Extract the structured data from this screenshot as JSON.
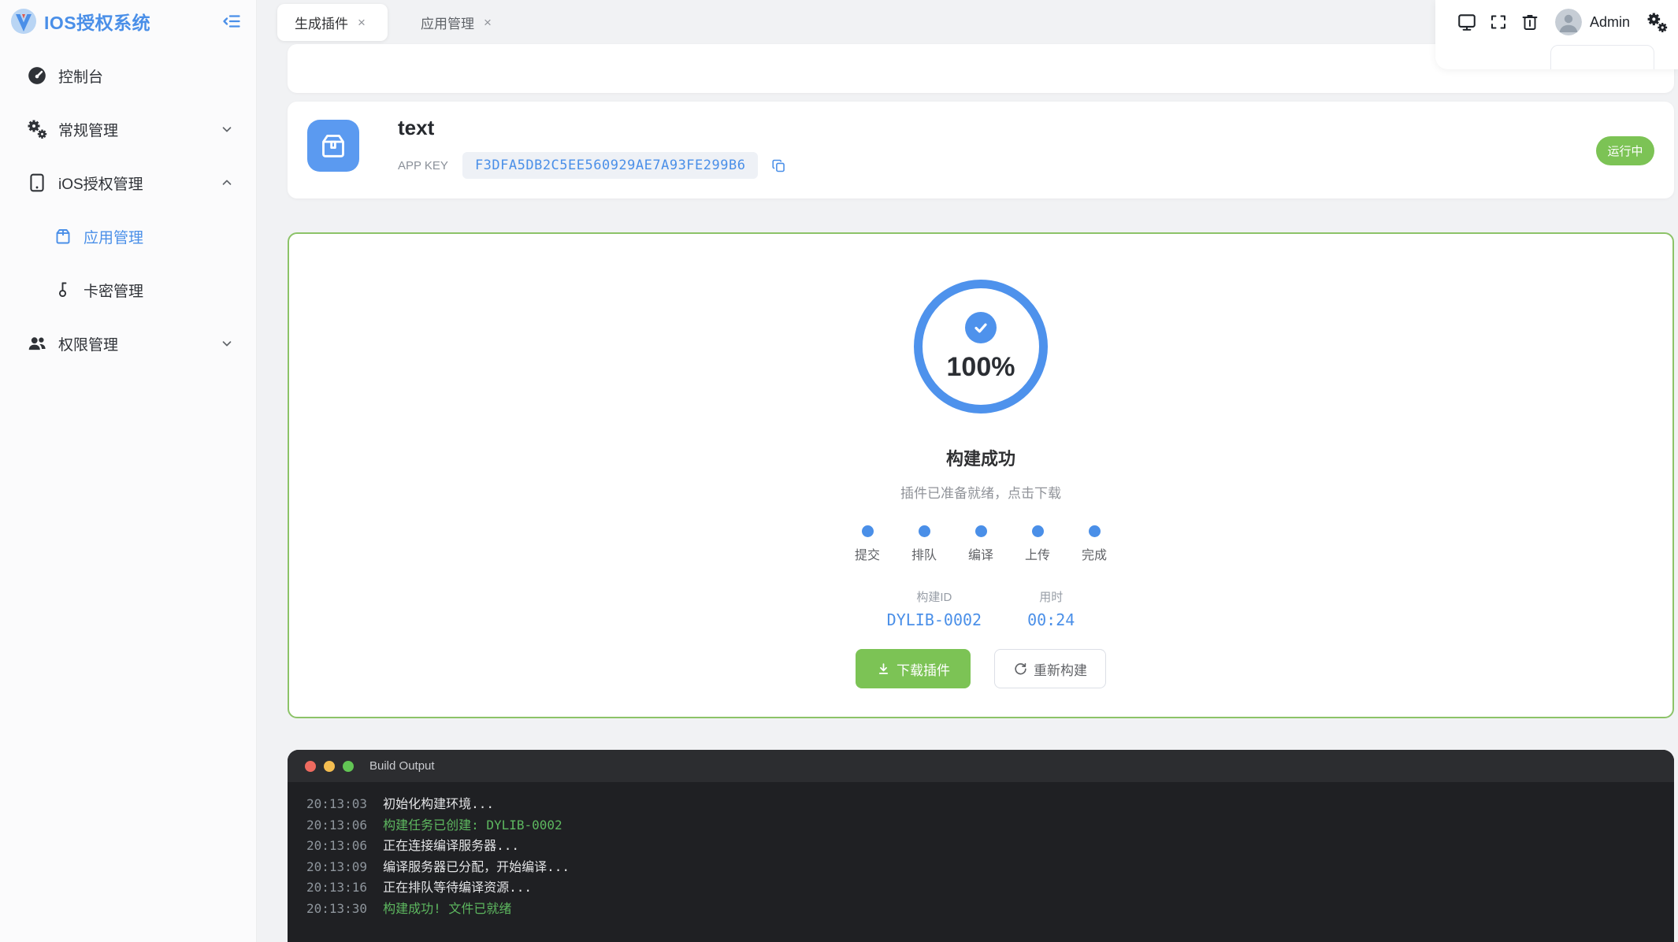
{
  "brand": {
    "title": "IOS授权系统"
  },
  "sidebar": {
    "items": [
      {
        "label": "控制台"
      },
      {
        "label": "常规管理"
      },
      {
        "label": "iOS授权管理",
        "children": [
          {
            "label": "应用管理"
          },
          {
            "label": "卡密管理"
          }
        ]
      },
      {
        "label": "权限管理"
      }
    ]
  },
  "tabs": [
    {
      "label": "生成插件"
    },
    {
      "label": "应用管理"
    }
  ],
  "topbar": {
    "username": "Admin"
  },
  "icons": {
    "close": "×"
  },
  "app_card": {
    "name": "text",
    "app_key_label": "APP KEY",
    "app_key": "F3DFA5DB2C5EE560929AE7A93FE299B6",
    "status": "运行中"
  },
  "build": {
    "percent": "100%",
    "title": "构建成功",
    "subtitle": "插件已准备就绪，点击下载",
    "steps": [
      {
        "label": "提交"
      },
      {
        "label": "排队"
      },
      {
        "label": "编译"
      },
      {
        "label": "上传"
      },
      {
        "label": "完成"
      }
    ],
    "build_id_label": "构建ID",
    "build_id": "DYLIB-0002",
    "duration_label": "用时",
    "duration": "00:24",
    "download_label": "下载插件",
    "rebuild_label": "重新构建"
  },
  "terminal": {
    "title": "Build Output",
    "lines": [
      {
        "time": "20:13:03",
        "text": "初始化构建环境...",
        "status": "normal"
      },
      {
        "time": "20:13:06",
        "text": "构建任务已创建: DYLIB-0002",
        "status": "success"
      },
      {
        "time": "20:13:06",
        "text": "正在连接编译服务器...",
        "status": "normal"
      },
      {
        "time": "20:13:09",
        "text": "编译服务器已分配，开始编译...",
        "status": "normal"
      },
      {
        "time": "20:13:16",
        "text": "正在排队等待编译资源...",
        "status": "normal"
      },
      {
        "time": "20:13:30",
        "text": "构建成功! 文件已就绪",
        "status": "success"
      }
    ]
  },
  "colors": {
    "primary": "#4a8fe8",
    "success_green": "#7cc355",
    "panel_border": "#8cc368",
    "terminal_success": "#5db75f",
    "status_badge": "#7cc355"
  }
}
